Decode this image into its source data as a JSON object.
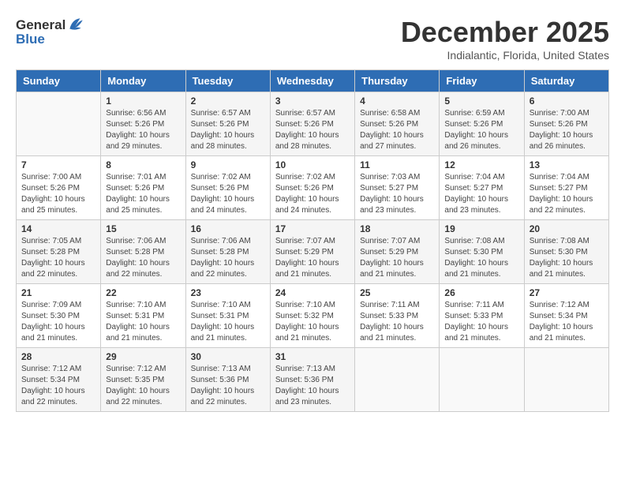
{
  "header": {
    "logo_line1": "General",
    "logo_line2": "Blue",
    "month": "December 2025",
    "location": "Indialantic, Florida, United States"
  },
  "weekdays": [
    "Sunday",
    "Monday",
    "Tuesday",
    "Wednesday",
    "Thursday",
    "Friday",
    "Saturday"
  ],
  "weeks": [
    [
      {
        "day": "",
        "info": ""
      },
      {
        "day": "1",
        "info": "Sunrise: 6:56 AM\nSunset: 5:26 PM\nDaylight: 10 hours\nand 29 minutes."
      },
      {
        "day": "2",
        "info": "Sunrise: 6:57 AM\nSunset: 5:26 PM\nDaylight: 10 hours\nand 28 minutes."
      },
      {
        "day": "3",
        "info": "Sunrise: 6:57 AM\nSunset: 5:26 PM\nDaylight: 10 hours\nand 28 minutes."
      },
      {
        "day": "4",
        "info": "Sunrise: 6:58 AM\nSunset: 5:26 PM\nDaylight: 10 hours\nand 27 minutes."
      },
      {
        "day": "5",
        "info": "Sunrise: 6:59 AM\nSunset: 5:26 PM\nDaylight: 10 hours\nand 26 minutes."
      },
      {
        "day": "6",
        "info": "Sunrise: 7:00 AM\nSunset: 5:26 PM\nDaylight: 10 hours\nand 26 minutes."
      }
    ],
    [
      {
        "day": "7",
        "info": "Sunrise: 7:00 AM\nSunset: 5:26 PM\nDaylight: 10 hours\nand 25 minutes."
      },
      {
        "day": "8",
        "info": "Sunrise: 7:01 AM\nSunset: 5:26 PM\nDaylight: 10 hours\nand 25 minutes."
      },
      {
        "day": "9",
        "info": "Sunrise: 7:02 AM\nSunset: 5:26 PM\nDaylight: 10 hours\nand 24 minutes."
      },
      {
        "day": "10",
        "info": "Sunrise: 7:02 AM\nSunset: 5:26 PM\nDaylight: 10 hours\nand 24 minutes."
      },
      {
        "day": "11",
        "info": "Sunrise: 7:03 AM\nSunset: 5:27 PM\nDaylight: 10 hours\nand 23 minutes."
      },
      {
        "day": "12",
        "info": "Sunrise: 7:04 AM\nSunset: 5:27 PM\nDaylight: 10 hours\nand 23 minutes."
      },
      {
        "day": "13",
        "info": "Sunrise: 7:04 AM\nSunset: 5:27 PM\nDaylight: 10 hours\nand 22 minutes."
      }
    ],
    [
      {
        "day": "14",
        "info": "Sunrise: 7:05 AM\nSunset: 5:28 PM\nDaylight: 10 hours\nand 22 minutes."
      },
      {
        "day": "15",
        "info": "Sunrise: 7:06 AM\nSunset: 5:28 PM\nDaylight: 10 hours\nand 22 minutes."
      },
      {
        "day": "16",
        "info": "Sunrise: 7:06 AM\nSunset: 5:28 PM\nDaylight: 10 hours\nand 22 minutes."
      },
      {
        "day": "17",
        "info": "Sunrise: 7:07 AM\nSunset: 5:29 PM\nDaylight: 10 hours\nand 21 minutes."
      },
      {
        "day": "18",
        "info": "Sunrise: 7:07 AM\nSunset: 5:29 PM\nDaylight: 10 hours\nand 21 minutes."
      },
      {
        "day": "19",
        "info": "Sunrise: 7:08 AM\nSunset: 5:30 PM\nDaylight: 10 hours\nand 21 minutes."
      },
      {
        "day": "20",
        "info": "Sunrise: 7:08 AM\nSunset: 5:30 PM\nDaylight: 10 hours\nand 21 minutes."
      }
    ],
    [
      {
        "day": "21",
        "info": "Sunrise: 7:09 AM\nSunset: 5:30 PM\nDaylight: 10 hours\nand 21 minutes."
      },
      {
        "day": "22",
        "info": "Sunrise: 7:10 AM\nSunset: 5:31 PM\nDaylight: 10 hours\nand 21 minutes."
      },
      {
        "day": "23",
        "info": "Sunrise: 7:10 AM\nSunset: 5:31 PM\nDaylight: 10 hours\nand 21 minutes."
      },
      {
        "day": "24",
        "info": "Sunrise: 7:10 AM\nSunset: 5:32 PM\nDaylight: 10 hours\nand 21 minutes."
      },
      {
        "day": "25",
        "info": "Sunrise: 7:11 AM\nSunset: 5:33 PM\nDaylight: 10 hours\nand 21 minutes."
      },
      {
        "day": "26",
        "info": "Sunrise: 7:11 AM\nSunset: 5:33 PM\nDaylight: 10 hours\nand 21 minutes."
      },
      {
        "day": "27",
        "info": "Sunrise: 7:12 AM\nSunset: 5:34 PM\nDaylight: 10 hours\nand 21 minutes."
      }
    ],
    [
      {
        "day": "28",
        "info": "Sunrise: 7:12 AM\nSunset: 5:34 PM\nDaylight: 10 hours\nand 22 minutes."
      },
      {
        "day": "29",
        "info": "Sunrise: 7:12 AM\nSunset: 5:35 PM\nDaylight: 10 hours\nand 22 minutes."
      },
      {
        "day": "30",
        "info": "Sunrise: 7:13 AM\nSunset: 5:36 PM\nDaylight: 10 hours\nand 22 minutes."
      },
      {
        "day": "31",
        "info": "Sunrise: 7:13 AM\nSunset: 5:36 PM\nDaylight: 10 hours\nand 23 minutes."
      },
      {
        "day": "",
        "info": ""
      },
      {
        "day": "",
        "info": ""
      },
      {
        "day": "",
        "info": ""
      }
    ]
  ]
}
